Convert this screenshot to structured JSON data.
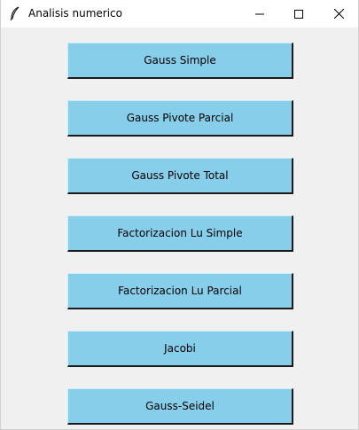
{
  "window": {
    "title": "Analisis numerico",
    "icon": "feather-icon",
    "controls": [
      "minimize-icon",
      "maximize-icon",
      "close-icon"
    ]
  },
  "colors": {
    "button_bg": "#87ceeb",
    "window_bg": "#f0f0f0"
  },
  "buttons": [
    {
      "label": "Gauss Simple"
    },
    {
      "label": "Gauss Pivote Parcial"
    },
    {
      "label": "Gauss Pivote Total"
    },
    {
      "label": "Factorizacion Lu Simple"
    },
    {
      "label": "Factorizacion Lu Parcial"
    },
    {
      "label": "Jacobi"
    },
    {
      "label": "Gauss-Seidel"
    }
  ]
}
